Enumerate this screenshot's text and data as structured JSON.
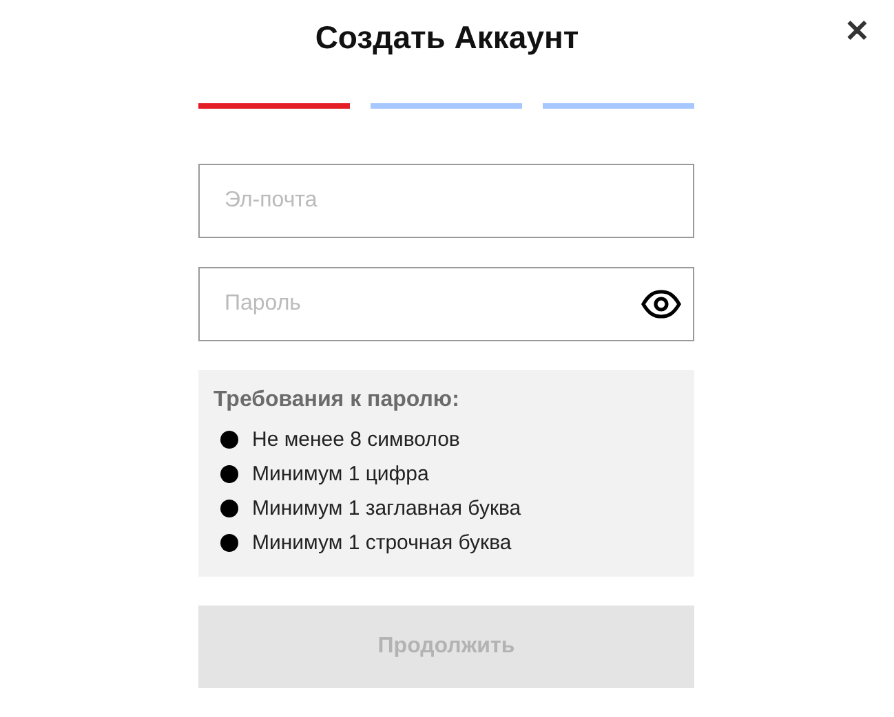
{
  "title": "Создать Аккаунт",
  "close": "✕",
  "steps": [
    {
      "selected": true
    },
    {
      "selected": false
    },
    {
      "selected": false
    }
  ],
  "email": {
    "placeholder": "Эл-почта"
  },
  "password": {
    "placeholder": "Пароль"
  },
  "requirements": {
    "heading": "Требования к паролю:",
    "items": [
      "Не менее 8 символов",
      "Минимум 1 цифра",
      "Минимум 1 заглавная буква",
      "Минимум 1 строчная буква"
    ]
  },
  "submit": {
    "label": "Продолжить",
    "disabled": true
  }
}
